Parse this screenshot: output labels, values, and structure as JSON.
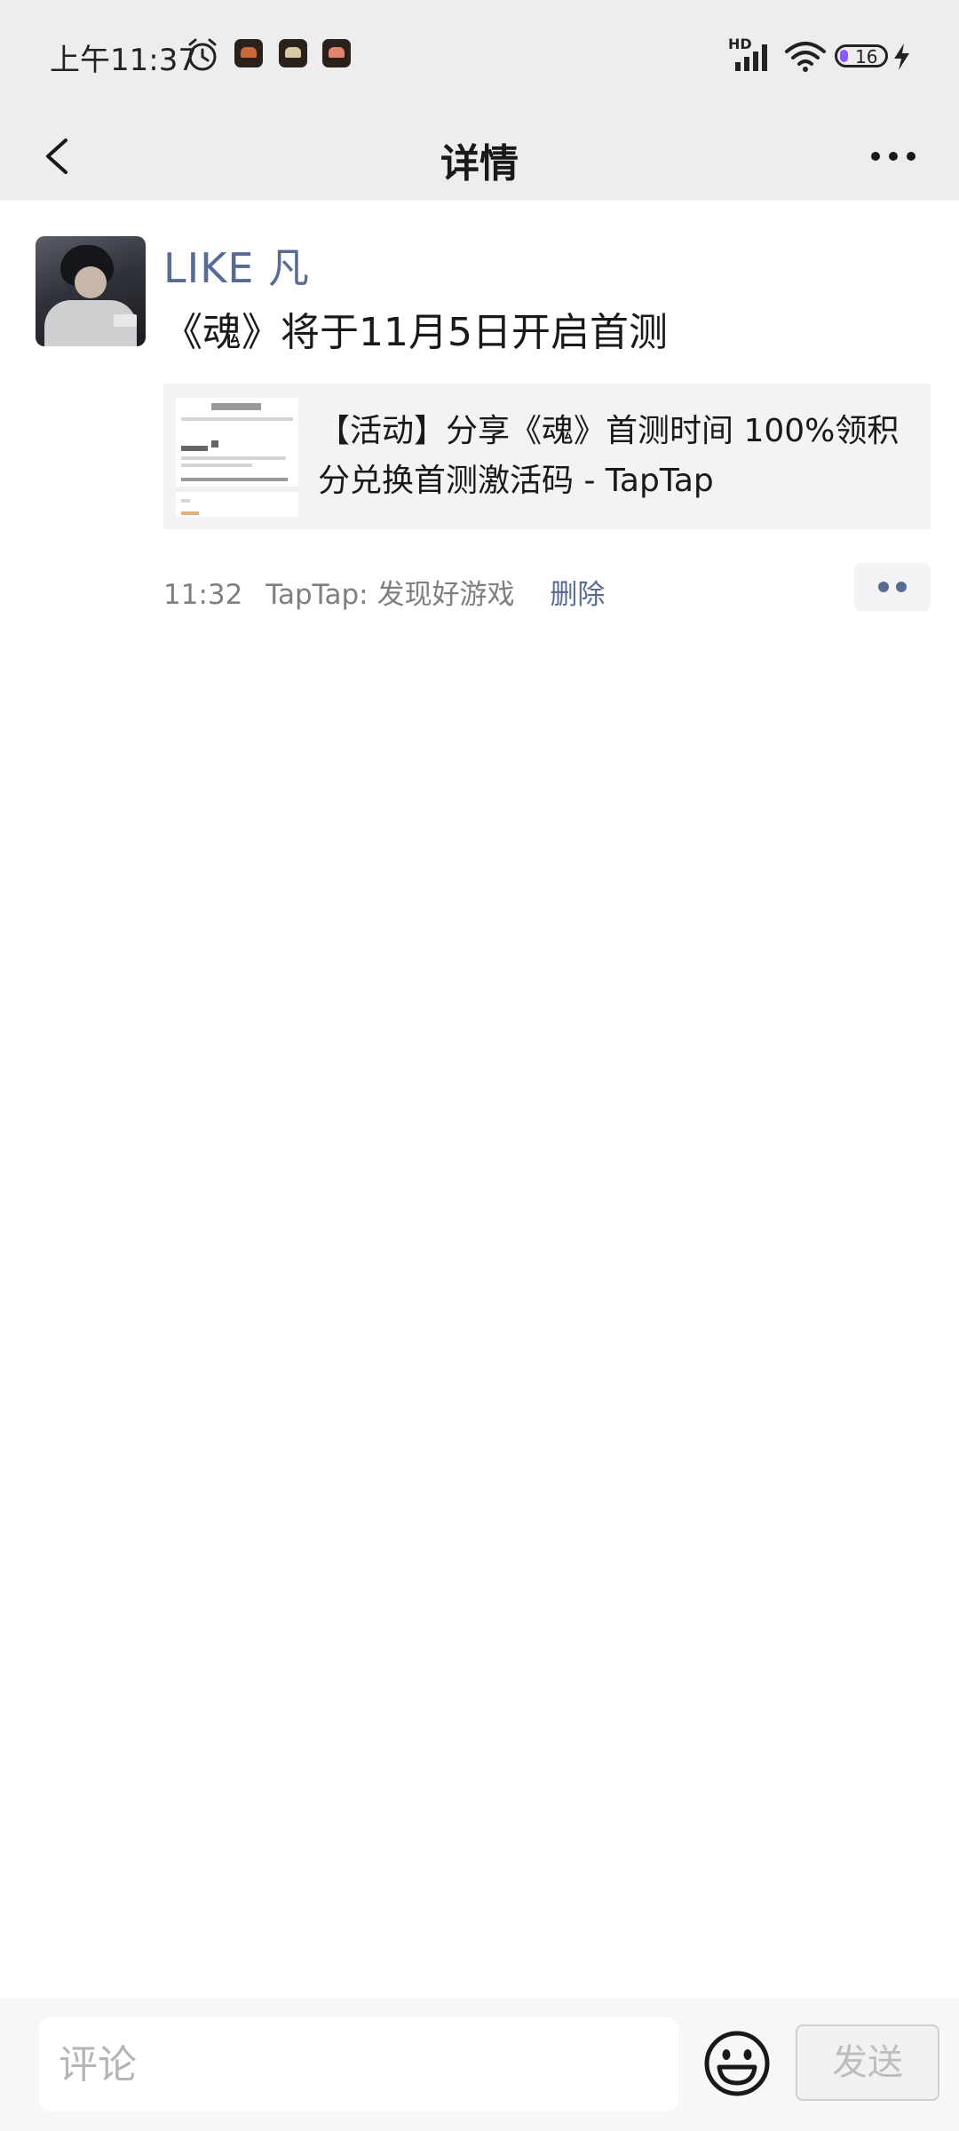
{
  "status_bar": {
    "time": "上午11:37",
    "network_label": "HD",
    "battery": "16",
    "icons": [
      "alarm-icon",
      "app-notification-icon",
      "app-notification-icon",
      "app-notification-icon",
      "signal-icon",
      "wifi-icon",
      "battery-icon",
      "charging-icon"
    ]
  },
  "nav": {
    "title": "详情",
    "back_icon": "chevron-left-icon",
    "more_icon": "more-dots-icon"
  },
  "post": {
    "author": "LIKE  凡",
    "text": "《魂》将于11月5日开启首测",
    "link": {
      "title": "【活动】分享《魂》首测时间 100%领积分兑换首测激活码 - TapTap",
      "thumb_text": "段博正文"
    },
    "time": "11:32",
    "source": "TapTap: 发现好游戏",
    "delete_label": "删除",
    "action_icon": "comment-like-dots-icon"
  },
  "comment_bar": {
    "placeholder": "评论",
    "emoji_icon": "emoji-icon",
    "send_label": "发送"
  },
  "colors": {
    "bar_bg": "#ededed",
    "link_blue": "#576b95",
    "card_bg": "#f3f3f5",
    "meta_gray": "#7f7f7f"
  }
}
